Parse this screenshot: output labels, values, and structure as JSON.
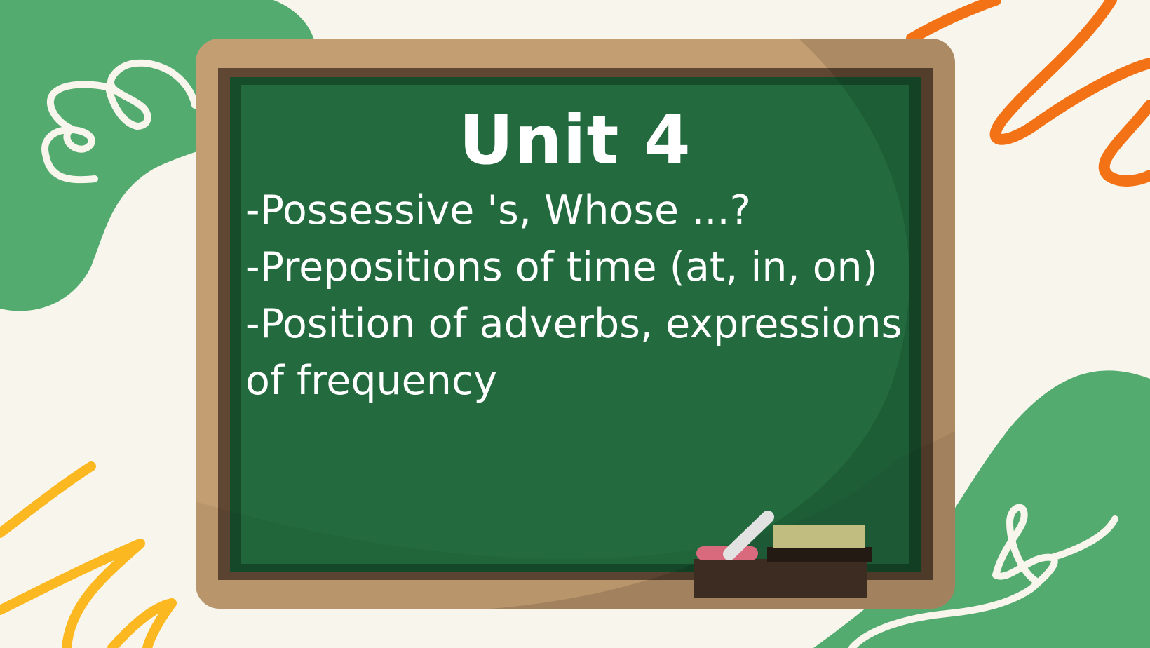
{
  "slide": {
    "title": "Unit 4",
    "topics": [
      "-Possessive 's, Whose ...?",
      "-Prepositions of time (at, in, on)",
      "-Position of adverbs, expressions of frequency"
    ]
  },
  "colors": {
    "background": "#f8f6ec",
    "blob_green": "#53ab70",
    "board_frame": "#c39e72",
    "board_green": "#236b3f",
    "scribble_orange": "#f47216",
    "scribble_yellow": "#fbb820",
    "scribble_cream": "#f8f6ec",
    "chalk_text": "#ffffff"
  },
  "icons": [
    "chalk-icon",
    "eraser-icon",
    "chalk-tray-icon"
  ]
}
